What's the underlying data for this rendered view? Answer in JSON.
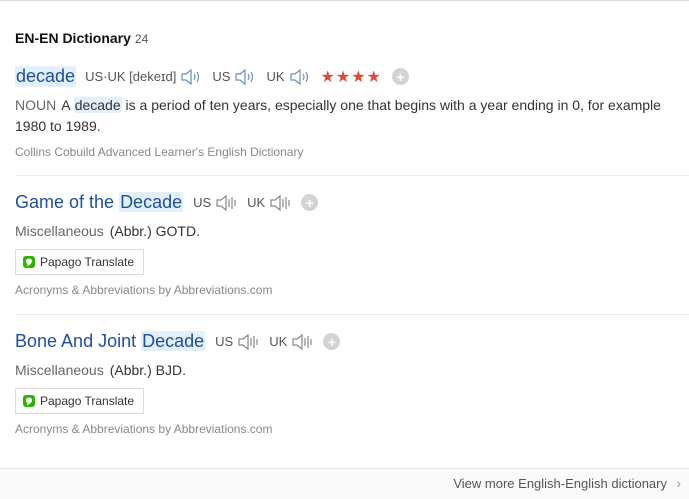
{
  "header": {
    "title": "EN-EN Dictionary",
    "count": "24"
  },
  "entries": [
    {
      "headword": "decade",
      "pron_label": "US·UK [dekeɪd]",
      "regions": [
        "US",
        "UK"
      ],
      "stars": "★★★★",
      "pos": "NOUN",
      "def_before": "A ",
      "def_highlight": "decade",
      "def_after": " is a period of ten years, especially one that begins with a year ending in 0, for example 1980 to 1989.",
      "source": "Collins Cobuild Advanced Learner's English Dictionary"
    },
    {
      "headword_pre": "Game of the ",
      "headword_hl": "Decade",
      "regions": [
        "US",
        "UK"
      ],
      "category": "Miscellaneous",
      "abbr": "(Abbr.) GOTD.",
      "translate_label": "Papago Translate",
      "source": "Acronyms & Abbreviations by Abbreviations.com"
    },
    {
      "headword_pre": "Bone And Joint ",
      "headword_hl": "Decade",
      "regions": [
        "US",
        "UK"
      ],
      "category": "Miscellaneous",
      "abbr": "(Abbr.) BJD.",
      "translate_label": "Papago Translate",
      "source": "Acronyms & Abbreviations by Abbreviations.com"
    }
  ],
  "footer": {
    "more_label": "View more English-English dictionary",
    "chevron": "›"
  },
  "icons": {
    "speaker": "speaker-icon",
    "add": "add-icon",
    "papago": "papago-icon"
  },
  "colors": {
    "link": "#1f4fa0",
    "highlight_bg": "#e3effa",
    "stars": "#e04a3a"
  }
}
